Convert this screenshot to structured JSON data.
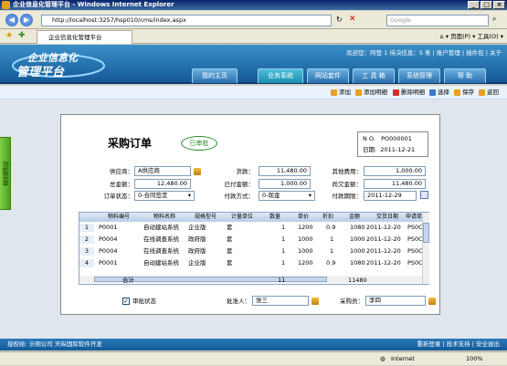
{
  "window": {
    "title": "企业信息化管理平台 - Windows Internet Explorer"
  },
  "browser": {
    "url": "http://localhost:3257/hsp010/cms/index.aspx",
    "search_placeholder": "Google",
    "tab_title": "企业信息化管理平台",
    "tools": "页面(P) ▾  工具(O) ▾"
  },
  "app": {
    "logo_line1": "企业信息化",
    "logo_line2": "管理平台",
    "welcome": "欢迎您：阿登 1 待决信息：5 条 | 账户管理 | 插件包 | 关于",
    "nav": [
      "我的主页",
      "业务系统",
      "网站套件",
      "工  具  箱",
      "系统管理",
      "帮   助"
    ],
    "toolbar": [
      "添加",
      "添加明细",
      "删除明细",
      "选择",
      "保存",
      "返回"
    ],
    "sidetab": "功能菜单",
    "footer_left": "授权给: 示例公司  天纵国际软件开发",
    "footer_right": "重新登录 | 技术支持 | 安全退出"
  },
  "order": {
    "title": "采购订单",
    "stamp": "已审批",
    "no_label": "N O.",
    "no_value": "PO000001",
    "date_label": "日期:",
    "date_value": "2011-12-21",
    "supplier_label": "供应商：",
    "supplier_value": "A供应商",
    "total_label": "总金额：",
    "total_value": "12,480.00",
    "status_label": "订单状态：",
    "status_value": "0-合同签定",
    "goods_label": "货款：",
    "goods_value": "11,480.00",
    "paid_label": "已付金额：",
    "paid_value": "1,000.00",
    "pay_method_label": "付款方式：",
    "pay_method_value": "0-现金",
    "other_fee_label": "其他费用：",
    "other_fee_value": "1,000.00",
    "balance_label": "尚欠金额：",
    "balance_value": "11,480.00",
    "due_label": "付款期限：",
    "due_value": "2011-12-29",
    "columns": [
      "物料编号",
      "物料名称",
      "规格型号",
      "计量单位",
      "数量",
      "单价",
      "折扣",
      "金额",
      "交货日期",
      "申请单"
    ],
    "rows": [
      {
        "n": "1",
        "code": "P0001",
        "name": "自动建站系统",
        "spec": "企业版",
        "unit": "套",
        "qty": "1",
        "price": "1200",
        "disc": "0.9",
        "amt": "1080",
        "date": "2011-12-20",
        "req": "PS0C"
      },
      {
        "n": "2",
        "code": "P0004",
        "name": "在线调查系统",
        "spec": "政府版",
        "unit": "套",
        "qty": "1",
        "price": "1000",
        "disc": "1",
        "amt": "1000",
        "date": "2011-12-20",
        "req": "PS0C"
      },
      {
        "n": "3",
        "code": "P0004",
        "name": "在线调查系统",
        "spec": "政府版",
        "unit": "套",
        "qty": "1",
        "price": "1000",
        "disc": "1",
        "amt": "1000",
        "date": "2011-12-20",
        "req": "PS0C"
      },
      {
        "n": "4",
        "code": "P0001",
        "name": "自动建站系统",
        "spec": "企业版",
        "unit": "套",
        "qty": "1",
        "price": "1200",
        "disc": "0.9",
        "amt": "1080",
        "date": "2011-12-20",
        "req": "PS0C"
      }
    ],
    "sum_label": "合计",
    "sum_qty": "11",
    "sum_amt": "11480",
    "approve_label": "审批状态",
    "approver_label": "批准人：",
    "approver_value": "张三",
    "buyer_label": "采购员：",
    "buyer_value": "李四"
  },
  "ie_status": {
    "zone": "Internet",
    "zoom": "100%"
  }
}
